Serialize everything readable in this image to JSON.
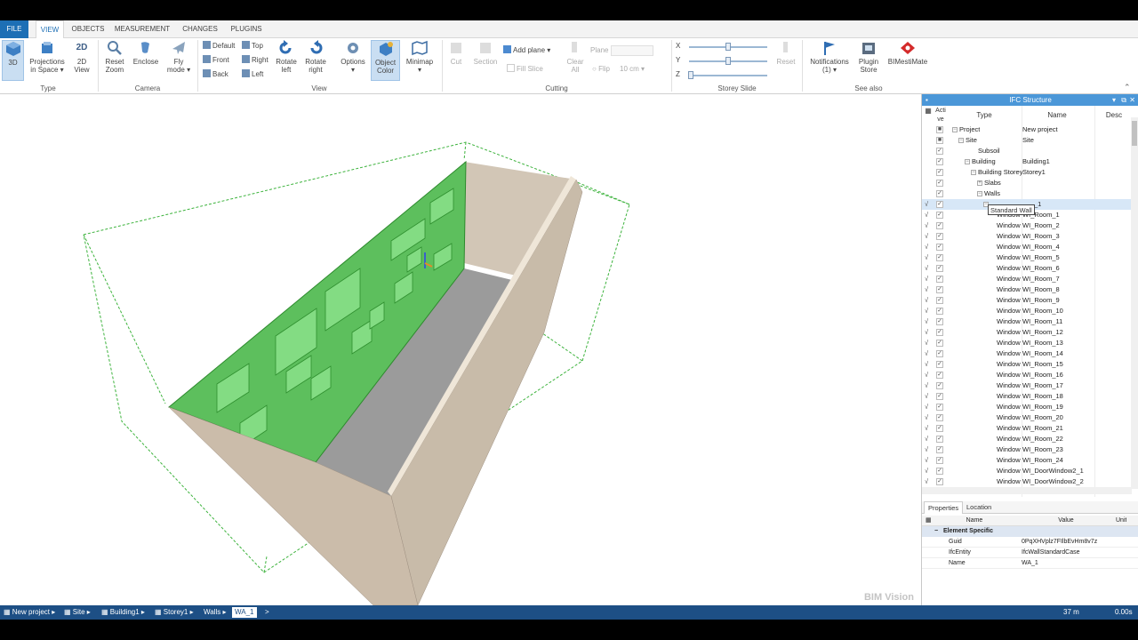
{
  "ribbon_tabs": [
    {
      "label": "FILE"
    },
    {
      "label": "VIEW"
    },
    {
      "label": "OBJECTS"
    },
    {
      "label": "MEASUREMENT"
    },
    {
      "label": "CHANGES"
    },
    {
      "label": "PLUGINS"
    }
  ],
  "ribbon": {
    "type_group": {
      "label": "Type",
      "btn_3d": "3D",
      "btn_projections_1": "Projections",
      "btn_projections_2": "in Space",
      "btn_2d_1": "2D",
      "btn_2d_2": "View",
      "icon_2d": "2D"
    },
    "camera_group": {
      "label": "Camera",
      "reset_zoom_1": "Reset",
      "reset_zoom_2": "Zoom",
      "enclose": "Enclose",
      "fly_1": "Fly",
      "fly_2": "mode"
    },
    "view_group": {
      "label": "View",
      "default": "Default",
      "top": "Top",
      "front": "Front",
      "right": "Right",
      "back": "Back",
      "left": "Left",
      "rotate_left_1": "Rotate",
      "rotate_left_2": "left",
      "rotate_right_1": "Rotate",
      "rotate_right_2": "right",
      "options": "Options",
      "object_color_1": "Object",
      "object_color_2": "Color",
      "minimap": "Minimap"
    },
    "cutting_group": {
      "label": "Cutting",
      "cut": "Cut",
      "section": "Section",
      "add_plane": "Add plane",
      "fill_slice": "Fill Slice",
      "plane": "Plane",
      "clear_all_1": "Clear",
      "clear_all_2": "All",
      "flip": "Flip",
      "thickness": "10 cm"
    },
    "storey_group": {
      "label": "Storey Slide",
      "x": "X",
      "y": "Y",
      "z": "Z",
      "reset": "Reset"
    },
    "see_also_group": {
      "label": "See also",
      "notifications_1": "Notifications",
      "notifications_2": "(1)",
      "plugin_store_1": "Plugin",
      "plugin_store_2": "Store",
      "bimestimate": "BIMestiMate"
    }
  },
  "viewport": {
    "watermark": "BIM Vision"
  },
  "ifc_panel": {
    "title": "IFC Structure",
    "col_active": "Acti ve",
    "col_type": "Type",
    "col_name": "Name",
    "col_desc": "Desc",
    "tooltip": "Standard Wall",
    "rows": [
      {
        "type": "Project",
        "name": "New project",
        "indent": 0
      },
      {
        "type": "Site",
        "name": "Site",
        "indent": 1
      },
      {
        "type": "Subsoil",
        "name": "",
        "indent": 3
      },
      {
        "type": "Building",
        "name": "Building1",
        "indent": 2
      },
      {
        "type": "Building Storey",
        "name": "Storey1",
        "indent": 3
      },
      {
        "type": "Slabs",
        "name": "",
        "indent": 4
      },
      {
        "type": "Walls",
        "name": "",
        "indent": 4
      },
      {
        "type": "",
        "name": "_1",
        "indent": 5
      },
      {
        "type": "Window",
        "name": "WI_Room_1",
        "indent": 6
      },
      {
        "type": "Window",
        "name": "WI_Room_2",
        "indent": 6
      },
      {
        "type": "Window",
        "name": "WI_Room_3",
        "indent": 6
      },
      {
        "type": "Window",
        "name": "WI_Room_4",
        "indent": 6
      },
      {
        "type": "Window",
        "name": "WI_Room_5",
        "indent": 6
      },
      {
        "type": "Window",
        "name": "WI_Room_6",
        "indent": 6
      },
      {
        "type": "Window",
        "name": "WI_Room_7",
        "indent": 6
      },
      {
        "type": "Window",
        "name": "WI_Room_8",
        "indent": 6
      },
      {
        "type": "Window",
        "name": "WI_Room_9",
        "indent": 6
      },
      {
        "type": "Window",
        "name": "WI_Room_10",
        "indent": 6
      },
      {
        "type": "Window",
        "name": "WI_Room_11",
        "indent": 6
      },
      {
        "type": "Window",
        "name": "WI_Room_12",
        "indent": 6
      },
      {
        "type": "Window",
        "name": "WI_Room_13",
        "indent": 6
      },
      {
        "type": "Window",
        "name": "WI_Room_14",
        "indent": 6
      },
      {
        "type": "Window",
        "name": "WI_Room_15",
        "indent": 6
      },
      {
        "type": "Window",
        "name": "WI_Room_16",
        "indent": 6
      },
      {
        "type": "Window",
        "name": "WI_Room_17",
        "indent": 6
      },
      {
        "type": "Window",
        "name": "WI_Room_18",
        "indent": 6
      },
      {
        "type": "Window",
        "name": "WI_Room_19",
        "indent": 6
      },
      {
        "type": "Window",
        "name": "WI_Room_20",
        "indent": 6
      },
      {
        "type": "Window",
        "name": "WI_Room_21",
        "indent": 6
      },
      {
        "type": "Window",
        "name": "WI_Room_22",
        "indent": 6
      },
      {
        "type": "Window",
        "name": "WI_Room_23",
        "indent": 6
      },
      {
        "type": "Window",
        "name": "WI_Room_24",
        "indent": 6
      },
      {
        "type": "Window",
        "name": "WI_DoorWindow2_1",
        "indent": 6
      },
      {
        "type": "Window",
        "name": "WI_DoorWindow2_2",
        "indent": 6
      }
    ]
  },
  "properties": {
    "tab_properties": "Properties",
    "tab_location": "Location",
    "col_name": "Name",
    "col_value": "Value",
    "col_unit": "Unit",
    "section": "Element Specific",
    "rows": [
      {
        "name": "Guid",
        "value": "0PqXHVplz7FIlbEvHm8v7z"
      },
      {
        "name": "IfcEntity",
        "value": "IfcWallStandardCase"
      },
      {
        "name": "Name",
        "value": "WA_1"
      }
    ]
  },
  "statusbar": {
    "crumbs": [
      "New project",
      "Site",
      "Building1",
      "Storey1",
      "Walls",
      "WA_1"
    ],
    "distance": "37 m",
    "time": "0.00s"
  },
  "colors": {
    "accent": "#1d6fb5",
    "selection_green": "#5cc35c",
    "wall": "#cdbfae",
    "floor": "#9c9c9c",
    "status": "#1d4f85"
  }
}
